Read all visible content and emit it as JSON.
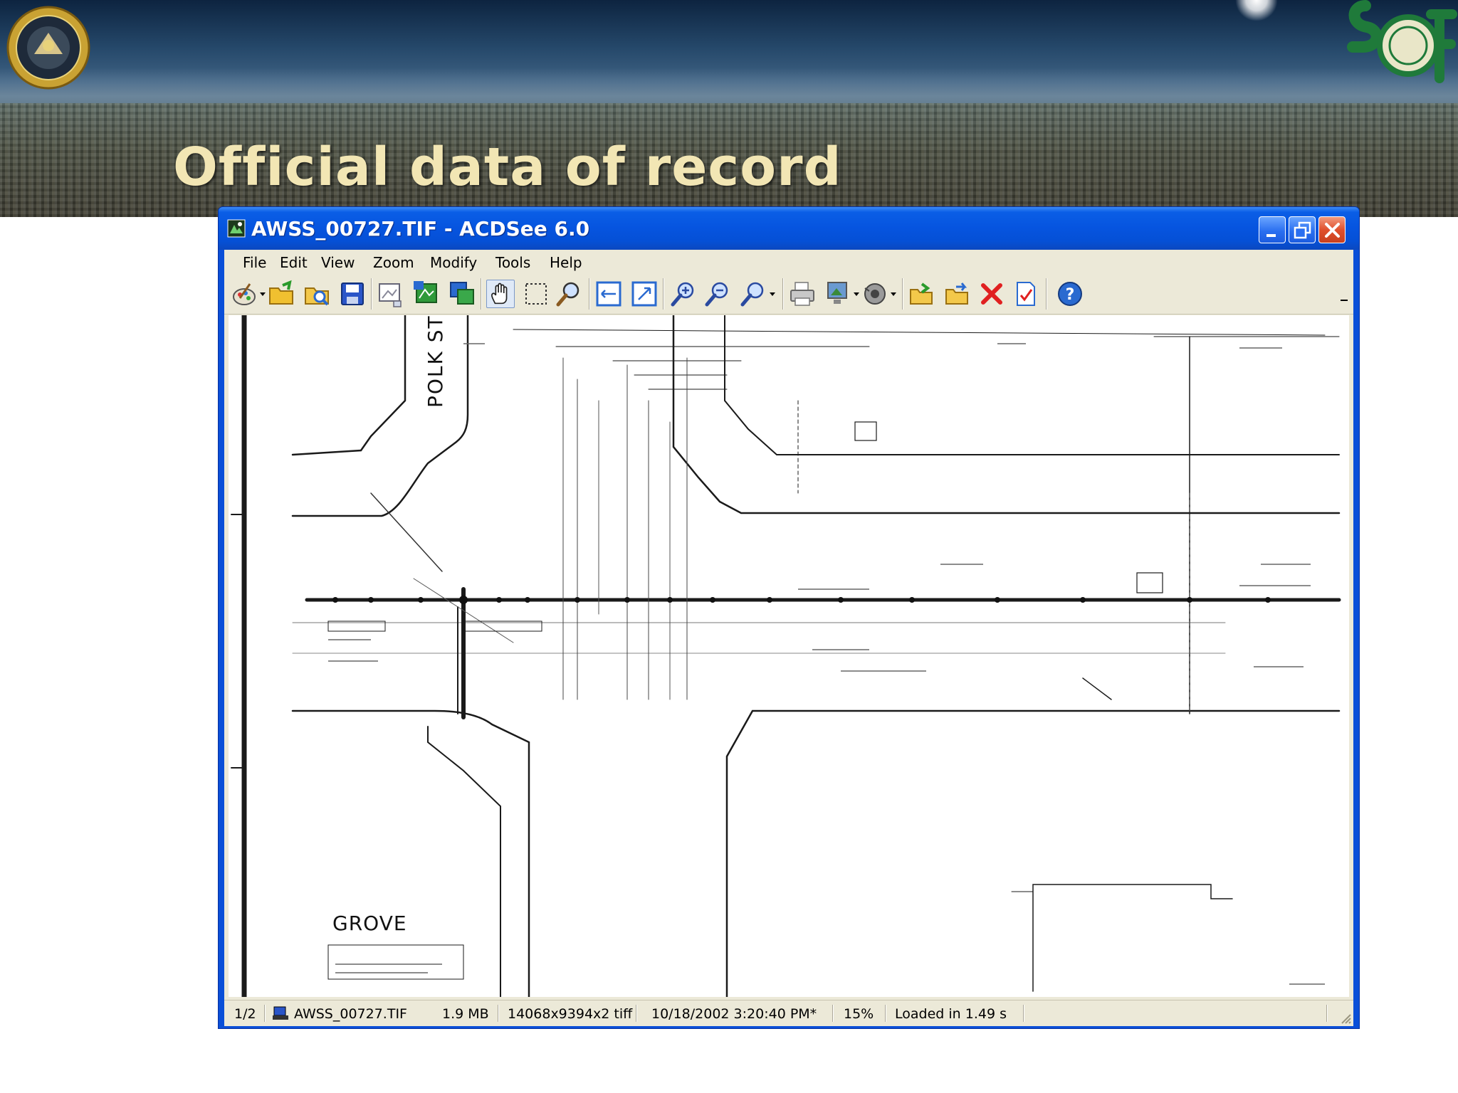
{
  "slide": {
    "title": "Official data of record"
  },
  "window": {
    "title": "AWSS_00727.TIF - ACDSee 6.0"
  },
  "menu": {
    "items": [
      "File",
      "Edit",
      "View",
      "Zoom",
      "Modify",
      "Tools",
      "Help"
    ]
  },
  "toolbar": {
    "buttons": [
      "acquire-icon",
      "browse-icon",
      "open-icon",
      "save-icon",
      "previous-image-icon",
      "next-image-icon",
      "slideshow-icon",
      "hand-tool-icon",
      "select-tool-icon",
      "zoom-tool-icon",
      "fit-width-icon",
      "fit-image-icon",
      "zoom-in-icon",
      "zoom-out-icon",
      "zoom-options-icon",
      "print-icon",
      "wallpaper-icon",
      "audio-icon",
      "copy-to-icon",
      "move-to-icon",
      "delete-icon",
      "properties-icon",
      "help-icon"
    ]
  },
  "drawing": {
    "street_labels": [
      "POLK STR",
      "GROVE"
    ]
  },
  "status": {
    "page": "1/2",
    "filename": "AWSS_00727.TIF",
    "filesize": "1.9 MB",
    "dimensions": "14068x9394x2 tiff",
    "modified": "10/18/2002 3:20:40 PM*",
    "zoom": "15%",
    "loaded": "Loaded in 1.49 s"
  },
  "colors": {
    "titlebar": "#0654df",
    "window_face": "#ece9d8",
    "slide_title": "#f2e6b4"
  }
}
